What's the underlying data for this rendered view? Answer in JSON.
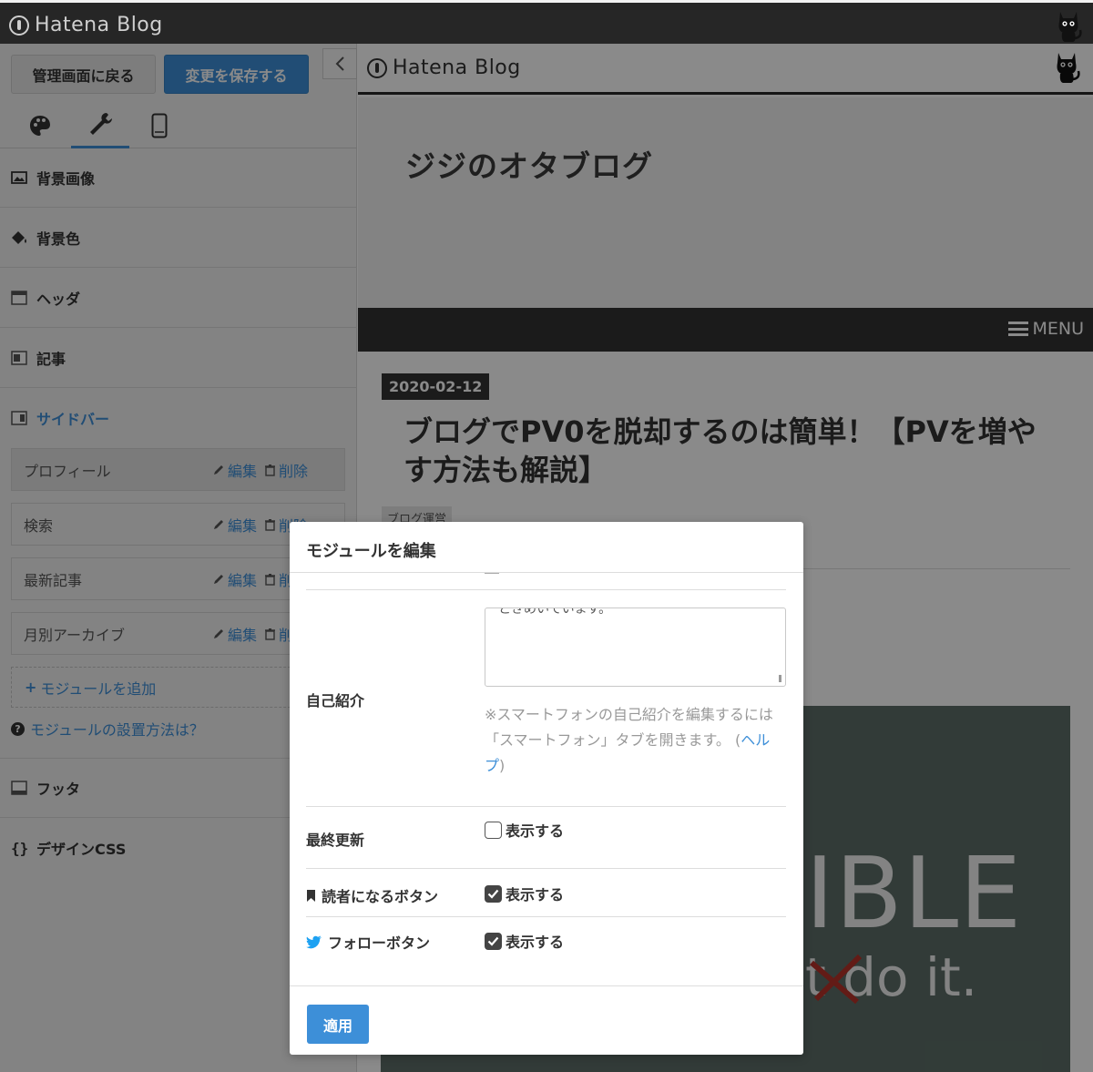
{
  "app": {
    "brand": "Hatena Blog"
  },
  "editor": {
    "back_label": "管理画面に戻る",
    "save_label": "変更を保存する",
    "tab_icons": [
      "palette-icon",
      "wrench-icon",
      "smartphone-icon"
    ],
    "sections": {
      "background_image": "背景画像",
      "background_color": "背景色",
      "header": "ヘッダ",
      "article": "記事",
      "sidebar": "サイドバー",
      "footer": "フッタ",
      "design_css": "デザインCSS",
      "design_css_glyph": "{}"
    },
    "modules": [
      {
        "name": "プロフィール",
        "edit": "編集",
        "delete": "削除"
      },
      {
        "name": "検索",
        "edit": "編集",
        "delete": "削除"
      },
      {
        "name": "最新記事",
        "edit": "編集",
        "delete": "削除"
      },
      {
        "name": "月別アーカイブ",
        "edit": "編集",
        "delete": "削除"
      }
    ],
    "add_module": "モジュールを追加",
    "add_module_prefix": "+",
    "help_link": "モジュールの設置方法は？",
    "help_glyph": "?"
  },
  "preview": {
    "brand": "Hatena Blog",
    "blog_title": "ジジのオタブログ",
    "menu_label": "MENU",
    "date": "2020-02-12",
    "article_title": "ブログでPV0を脱却するのは簡単！【PVを増やす方法も解説】",
    "category": "ブログ運営",
    "image_text_big": "IBLE",
    "image_text_small": "t do it."
  },
  "modal": {
    "title": "モジュールを編集",
    "self_intro_label": "自己紹介",
    "textarea_clipped_text": "ときめいています。",
    "note_text": "※スマートフォンの自己紹介を編集するには「スマートフォン」タブを開きます。",
    "note_paren_open": "(",
    "note_help_link": "ヘルプ",
    "note_paren_close": ")",
    "last_updated_label": "最終更新",
    "last_updated_checkbox": {
      "label": "表示する",
      "checked": false
    },
    "reader_button_label": "読者になるボタン",
    "reader_button_checkbox": {
      "label": "表示する",
      "checked": true
    },
    "follow_button_label": "フォローボタン",
    "follow_button_checkbox": {
      "label": "表示する",
      "checked": true
    },
    "apply_label": "適用"
  },
  "colors": {
    "accent": "#3d8fd8",
    "topbar": "#262626",
    "panel_bg": "#f2f2f2",
    "twitter": "#1da1f2"
  }
}
